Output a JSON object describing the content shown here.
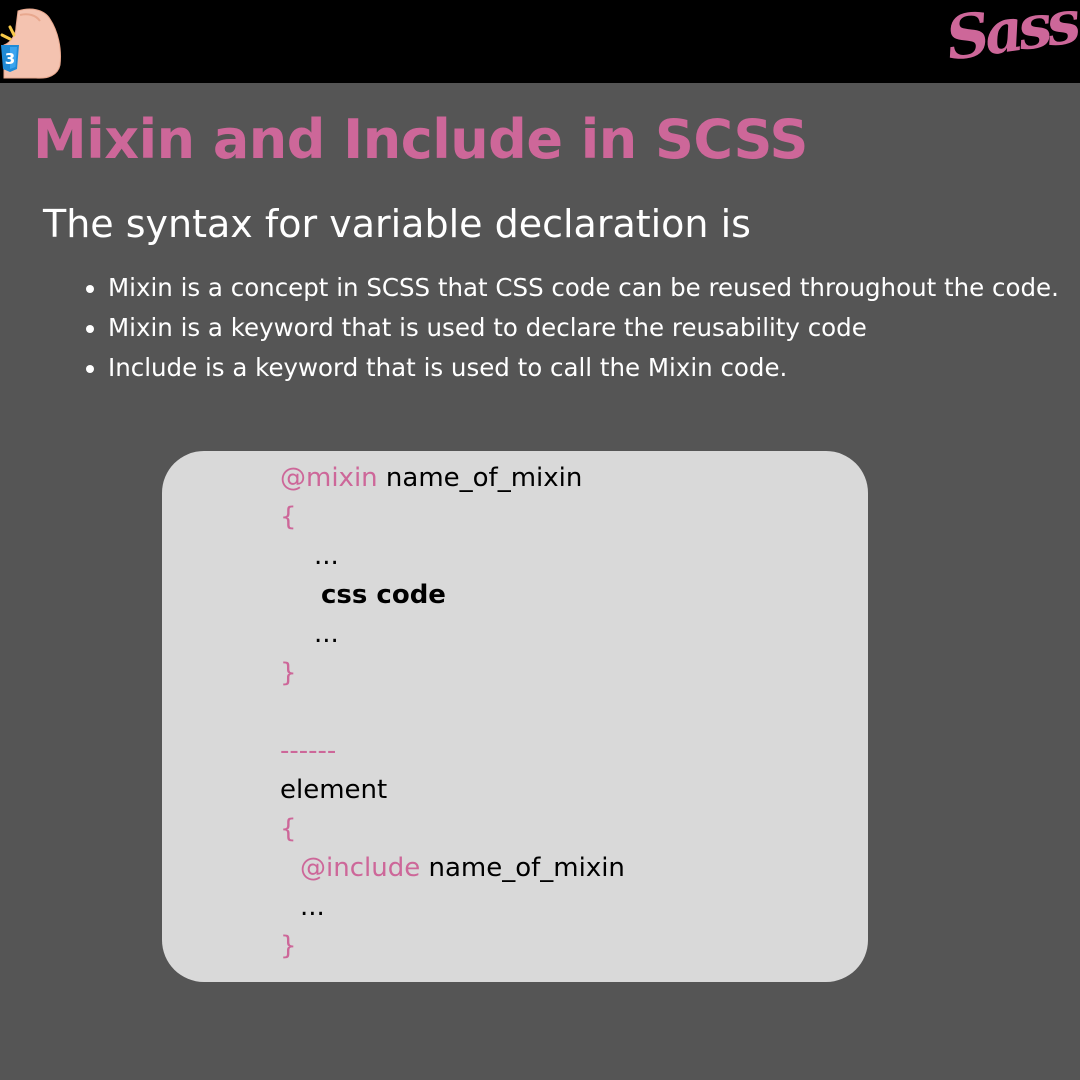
{
  "header": {
    "logo_left_icon": "css3-flexed-arm-icon",
    "logo_right_text": "Sass",
    "brand_color": "#cd6799"
  },
  "title": "Mixin and Include in SCSS",
  "subtitle": "The syntax for variable declaration is",
  "bullets": [
    "Mixin is a concept in SCSS that CSS code can be reused throughout the code.",
    "Mixin is a keyword that is used to declare the reusability code",
    "Include is a keyword that is used to call the Mixin code."
  ],
  "code": {
    "mixin_keyword": "@mixin",
    "mixin_name": " name_of_mixin",
    "open_brace_1": "{",
    "dots_1": "...",
    "css_code": "css code",
    "dots_2": "...",
    "close_brace_1": "}",
    "separator": "------",
    "element": "element",
    "open_brace_2": "{",
    "include_keyword": "@include",
    "include_name": " name_of_mixin",
    "dots_3": "...",
    "close_brace_2": "}"
  }
}
